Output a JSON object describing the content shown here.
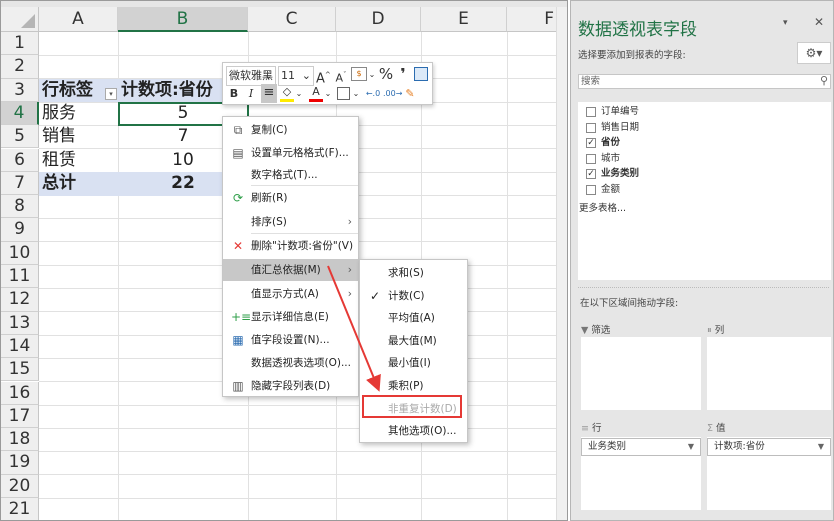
{
  "sheet": {
    "columns": [
      "A",
      "B",
      "C",
      "D",
      "E",
      "F"
    ],
    "rows": [
      "1",
      "2",
      "3",
      "4",
      "5",
      "6",
      "7",
      "8",
      "9",
      "10",
      "11",
      "12",
      "13",
      "14",
      "15",
      "16",
      "17",
      "18",
      "19",
      "20",
      "21"
    ],
    "pivot": {
      "header_row_label": "行标签",
      "header_value": "计数项:省份",
      "rows": [
        {
          "label": "服务",
          "value": "5"
        },
        {
          "label": "销售",
          "value": "7"
        },
        {
          "label": "租赁",
          "value": "10"
        }
      ],
      "total_label": "总计",
      "total_value": "22"
    },
    "band_color": "#d9e1f2",
    "selection_color": "#217346"
  },
  "mini_toolbar": {
    "font": "微软雅黑",
    "size": "11",
    "bold": "B",
    "italic": "I",
    "percent": "%",
    "comma": "❜"
  },
  "context_menu": {
    "items": [
      {
        "label": "复制(C)",
        "icon": "copy-icon"
      },
      {
        "label": "设置单元格格式(F)...",
        "icon": "format-cells-icon"
      },
      {
        "label": "数字格式(T)..."
      },
      {
        "label": "刷新(R)",
        "icon": "refresh-icon"
      },
      {
        "label": "排序(S)",
        "submenu": true
      },
      {
        "label": "删除\"计数项:省份\"(V)",
        "icon": "delete-icon"
      },
      {
        "label": "值汇总依据(M)",
        "submenu": true,
        "highlighted": true
      },
      {
        "label": "值显示方式(A)",
        "submenu": true
      },
      {
        "label": "显示详细信息(E)",
        "icon": "show-detail-icon"
      },
      {
        "label": "值字段设置(N)...",
        "icon": "field-settings-icon"
      },
      {
        "label": "数据透视表选项(O)..."
      },
      {
        "label": "隐藏字段列表(D)",
        "icon": "hide-field-list-icon"
      }
    ]
  },
  "submenu": {
    "items": [
      {
        "label": "求和(S)"
      },
      {
        "label": "计数(C)",
        "checked": true
      },
      {
        "label": "平均值(A)"
      },
      {
        "label": "最大值(M)"
      },
      {
        "label": "最小值(I)"
      },
      {
        "label": "乘积(P)"
      },
      {
        "label": "非重复计数(D)",
        "disabled": true,
        "highlighted_box": true
      },
      {
        "label": "其他选项(O)..."
      }
    ]
  },
  "annotation_color": "#e53935",
  "panel": {
    "title": "数据透视表字段",
    "choose_label": "选择要添加到报表的字段:",
    "search_placeholder": "搜索",
    "fields": [
      {
        "label": "订单编号",
        "checked": false
      },
      {
        "label": "销售日期",
        "checked": false
      },
      {
        "label": "省份",
        "checked": true
      },
      {
        "label": "城市",
        "checked": false
      },
      {
        "label": "业务类别",
        "checked": true
      },
      {
        "label": "金额",
        "checked": false
      }
    ],
    "more_tables": "更多表格...",
    "drag_label": "在以下区域间拖动字段:",
    "areas": {
      "filter": "筛选",
      "columns": "列",
      "rows": "行",
      "values": "值"
    },
    "rows_field": "业务类别",
    "values_field": "计数项:省份",
    "title_color": "#217346"
  }
}
